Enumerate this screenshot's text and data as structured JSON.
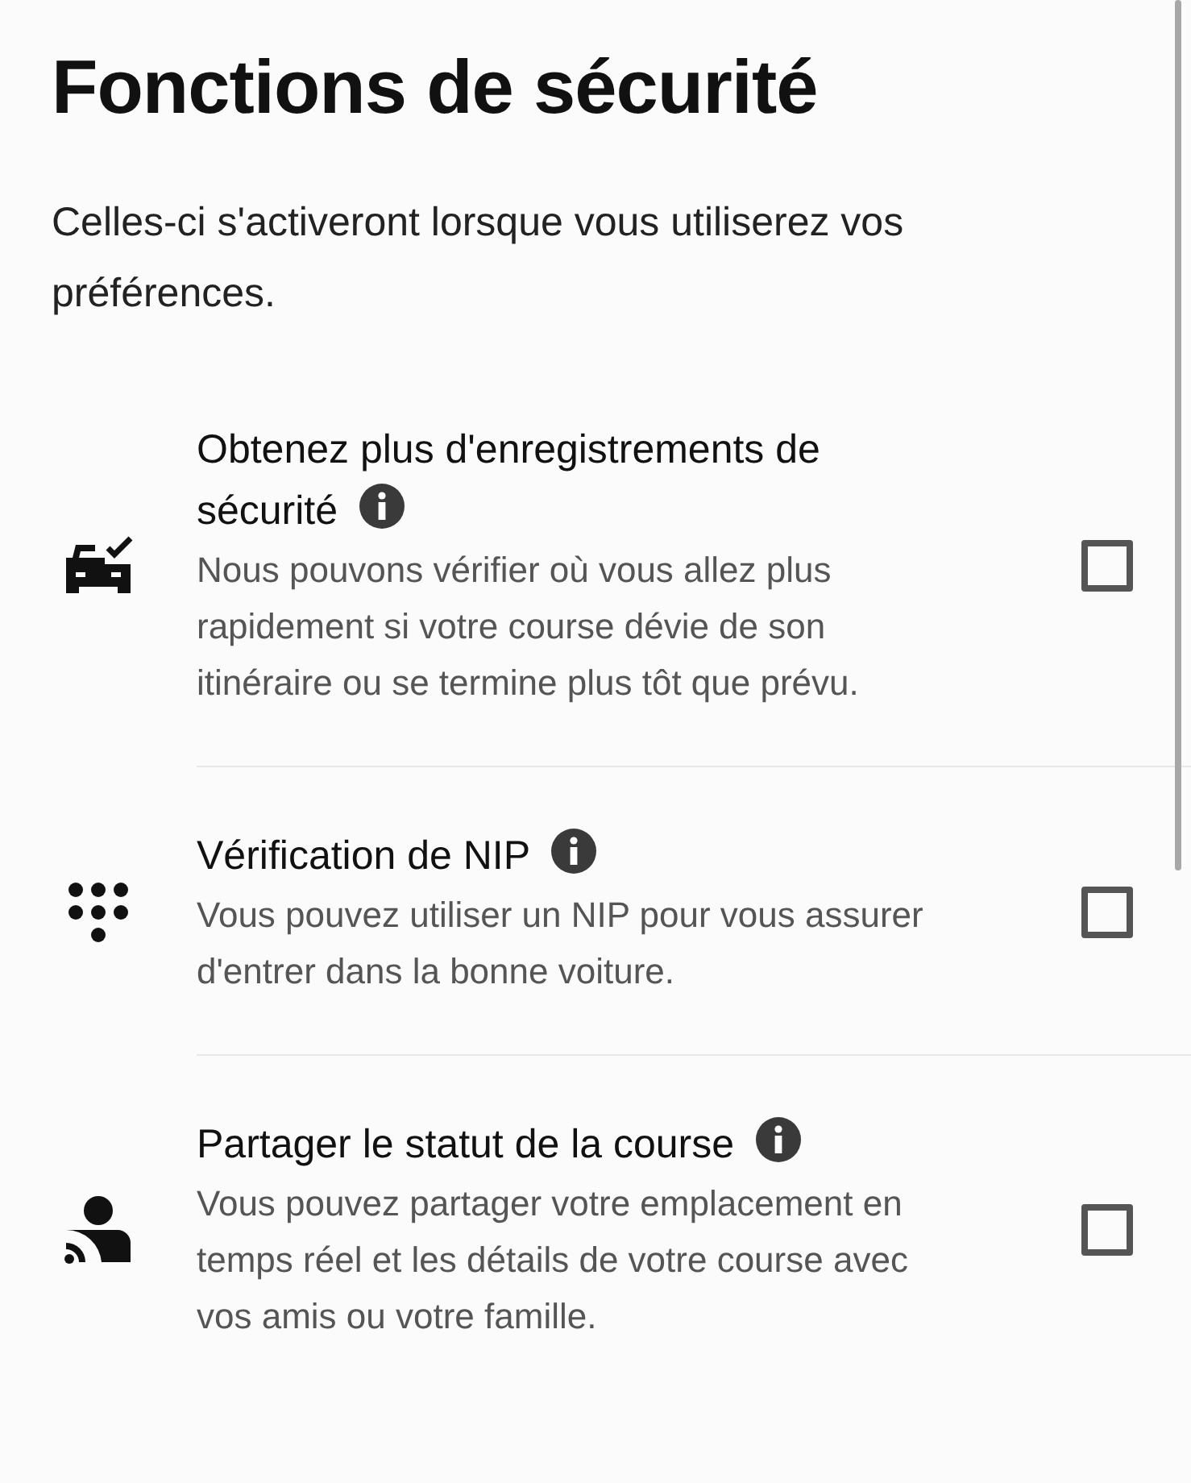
{
  "title": "Fonctions de sécurité",
  "subtitle": "Celles-ci s'activeront lorsque vous utiliserez vos préférences.",
  "features": [
    {
      "title": "Obtenez plus d'enregistrements de sécurité",
      "description": "Nous pouvons vérifier où vous allez plus rapidement si votre course dévie de son itinéraire ou se termine plus tôt que prévu.",
      "checked": false
    },
    {
      "title": "Vérification de NIP",
      "description": "Vous pouvez utiliser un NIP pour vous assurer d'entrer dans la bonne voiture.",
      "checked": false
    },
    {
      "title": "Partager le statut de la course",
      "description": "Vous pouvez partager votre emplacement en temps réel et les détails de votre course avec vos amis ou votre famille.",
      "checked": false
    }
  ]
}
